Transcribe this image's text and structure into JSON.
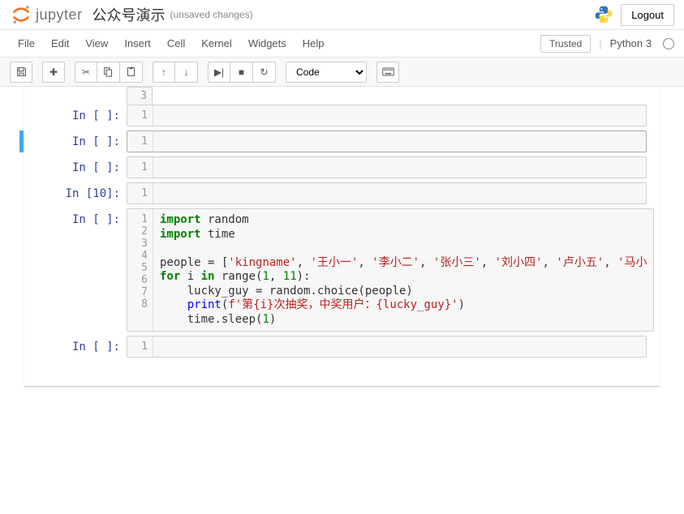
{
  "header": {
    "logo_text": "jupyter",
    "notebook_name": "公众号演示",
    "unsaved_label": "(unsaved changes)",
    "logout_label": "Logout"
  },
  "menubar": {
    "items": [
      "File",
      "Edit",
      "View",
      "Insert",
      "Cell",
      "Kernel",
      "Widgets",
      "Help"
    ],
    "trusted_label": "Trusted",
    "kernel_name": "Python 3"
  },
  "toolbar": {
    "cell_type": "Code"
  },
  "cells": [
    {
      "prompt": "In [ ]:",
      "gutter": [
        "1"
      ],
      "code": "",
      "prev_gutter": "3"
    },
    {
      "prompt": "In [ ]:",
      "gutter": [
        "1"
      ],
      "code": "",
      "selected": true
    },
    {
      "prompt": "In [ ]:",
      "gutter": [
        "1"
      ],
      "code": ""
    },
    {
      "prompt": "In [10]:",
      "gutter": [
        "1"
      ],
      "code": ""
    },
    {
      "prompt": "In [ ]:",
      "gutter": [
        "1",
        "2",
        "3",
        "4",
        "5",
        "6",
        "7",
        "8"
      ],
      "code_tokens": [
        [
          {
            "t": "import",
            "c": "kw"
          },
          {
            "t": " random"
          }
        ],
        [
          {
            "t": "import",
            "c": "kw"
          },
          {
            "t": " time"
          }
        ],
        [],
        [
          {
            "t": "people = ["
          },
          {
            "t": "'kingname'",
            "c": "str"
          },
          {
            "t": ", "
          },
          {
            "t": "'王小一'",
            "c": "str"
          },
          {
            "t": ", "
          },
          {
            "t": "'李小二'",
            "c": "str"
          },
          {
            "t": ", "
          },
          {
            "t": "'张小三'",
            "c": "str"
          },
          {
            "t": ", "
          },
          {
            "t": "'刘小四'",
            "c": "str"
          },
          {
            "t": ", "
          },
          {
            "t": "'卢小五'",
            "c": "str"
          },
          {
            "t": ", "
          },
          {
            "t": "'马小",
            "c": "str"
          }
        ],
        [
          {
            "t": "for",
            "c": "kw"
          },
          {
            "t": " i "
          },
          {
            "t": "in",
            "c": "kw"
          },
          {
            "t": " range("
          },
          {
            "t": "1",
            "c": "num"
          },
          {
            "t": ", "
          },
          {
            "t": "11",
            "c": "num"
          },
          {
            "t": "):"
          }
        ],
        [
          {
            "t": "    lucky_guy = random.choice(people)"
          }
        ],
        [
          {
            "t": "    "
          },
          {
            "t": "print",
            "c": "fn"
          },
          {
            "t": "("
          },
          {
            "t": "f'第{i}次抽奖，中奖用户：{lucky_guy}'",
            "c": "str"
          },
          {
            "t": ")"
          }
        ],
        [
          {
            "t": "    time.sleep("
          },
          {
            "t": "1",
            "c": "num"
          },
          {
            "t": ")"
          }
        ]
      ]
    },
    {
      "prompt": "In [ ]:",
      "gutter": [
        "1"
      ],
      "code": ""
    }
  ]
}
